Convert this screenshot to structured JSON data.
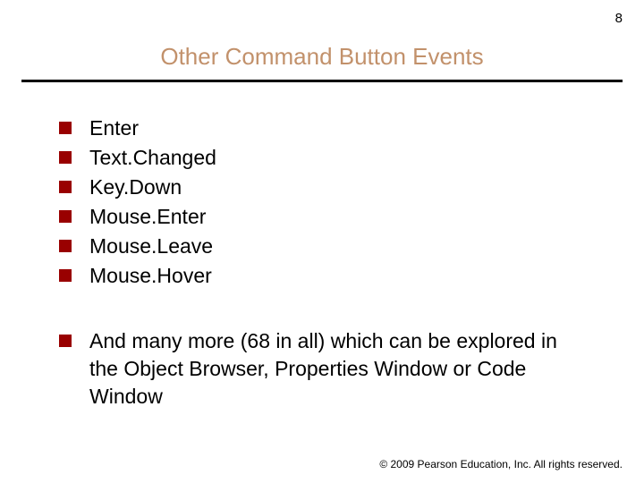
{
  "page_number": "8",
  "title": "Other Command Button Events",
  "bullets_group1": [
    "Enter",
    "Text.Changed",
    "Key.Down",
    "Mouse.Enter",
    "Mouse.Leave",
    "Mouse.Hover"
  ],
  "bullets_group2": [
    "And many more (68 in all) which can be explored in the Object Browser, Properties Window or Code Window"
  ],
  "footer": "© 2009 Pearson Education, Inc.  All rights reserved."
}
